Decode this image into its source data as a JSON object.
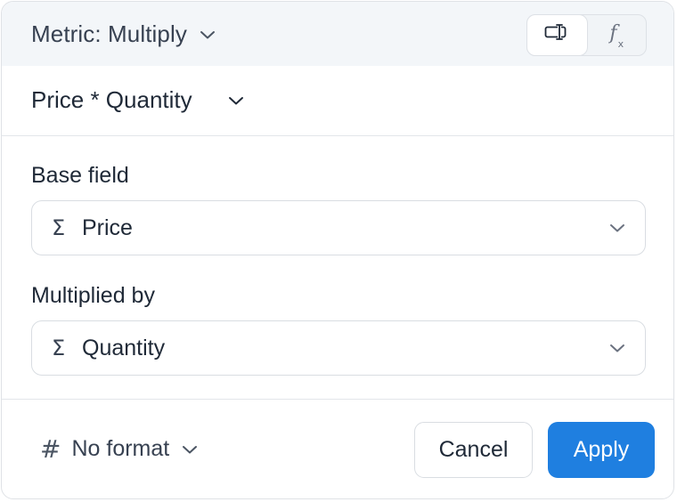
{
  "header": {
    "title": "Metric: Multiply",
    "mode_toggle": {
      "active": "column",
      "options": [
        {
          "icon": "column-picker-icon"
        },
        {
          "icon": "fx-icon",
          "label": "f",
          "sub": "x"
        }
      ]
    }
  },
  "expression": {
    "text": "Price * Quantity"
  },
  "fields": {
    "base": {
      "label": "Base field",
      "icon": "sigma-icon",
      "icon_glyph": "Σ",
      "value": "Price"
    },
    "multiplier": {
      "label": "Multiplied by",
      "icon": "sigma-icon",
      "icon_glyph": "Σ",
      "value": "Quantity"
    }
  },
  "footer": {
    "format_icon_glyph": "#",
    "format_label": "No format",
    "cancel_label": "Cancel",
    "apply_label": "Apply"
  },
  "colors": {
    "header_bg": "#f3f6f9",
    "primary": "#1f7fe0",
    "border": "#d9dde2"
  }
}
